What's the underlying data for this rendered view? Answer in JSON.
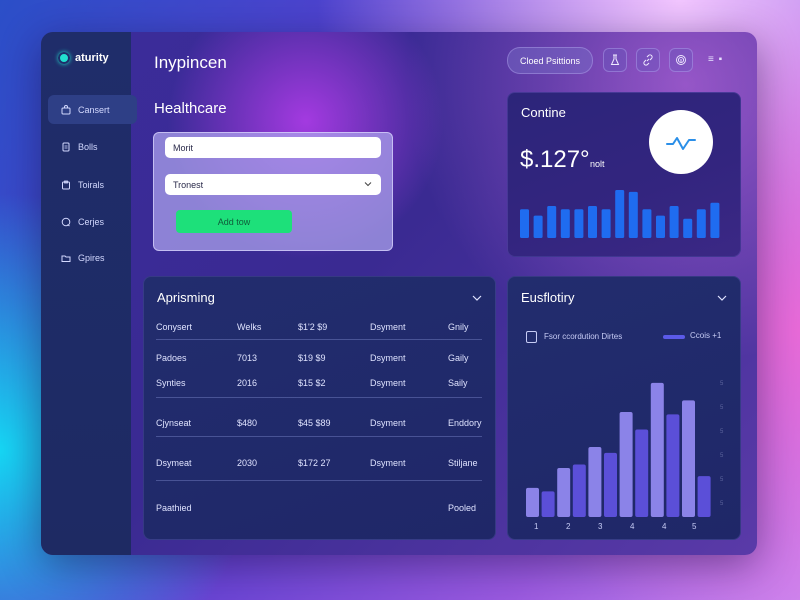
{
  "app": {
    "logo_text": "aturity",
    "title": "Inypincen",
    "top_button": "Cloed Psittions",
    "top_icons": [
      "flask-icon",
      "link-icon",
      "fingerprint-icon"
    ],
    "menu": "≡ ▪"
  },
  "sidebar": {
    "items": [
      {
        "label": "Cansert",
        "icon": "bag-icon",
        "active": true
      },
      {
        "label": "Bolls",
        "icon": "document-icon",
        "active": false
      },
      {
        "label": "Toirals",
        "icon": "clipboard-icon",
        "active": false
      },
      {
        "label": "Cerjes",
        "icon": "chat-icon",
        "active": false
      },
      {
        "label": "Gpires",
        "icon": "folder-icon",
        "active": false
      }
    ]
  },
  "form": {
    "section_title": "Healthcare",
    "field1_value": "Morit",
    "field2_value": "Tronest",
    "button_label": "Add tow"
  },
  "stat_card": {
    "title": "Contine",
    "value": "$.127°",
    "unit": "nolt",
    "bars": [
      0.45,
      0.35,
      0.5,
      0.45,
      0.45,
      0.5,
      0.45,
      0.75,
      0.72,
      0.45,
      0.35,
      0.5,
      0.3,
      0.45,
      0.55
    ]
  },
  "table": {
    "title": "Aprisming",
    "rows": [
      [
        "Conysert",
        "Welks",
        "$1'2 $9",
        "Dsyment",
        "Gnily"
      ],
      [
        "Padoes",
        "7013",
        "$19 $9",
        "Dsyment",
        "Gaily"
      ],
      [
        "Synties",
        "2016",
        "$15 $2",
        "Dsyment",
        "Saily"
      ],
      [
        "Cjynseat",
        "$480",
        "$45 $89",
        "Dsyment",
        "Enddory"
      ],
      [
        "Dsymeat",
        "2030",
        "$172 27",
        "Dsyment",
        "Stiljane"
      ],
      [
        "Paathied",
        "",
        "",
        "",
        "Pooled"
      ]
    ]
  },
  "chart_data": {
    "type": "bar",
    "title": "Eusflotiry",
    "legend_label": "Fsor ccordution Dirtes",
    "series": [
      {
        "name": "Ccois +1",
        "color": "#8b83e8",
        "values": [
          25,
          30,
          42,
          50,
          60,
          62,
          90,
          80,
          115,
          95,
          100,
          40
        ]
      },
      {
        "name": "",
        "color": "#5b4fd8",
        "values": [
          18,
          22,
          36,
          45,
          52,
          55,
          82,
          75,
          108,
          88,
          92,
          35
        ]
      }
    ],
    "categories": [
      "1",
      "2",
      "3",
      "4",
      "4",
      "5"
    ],
    "ylim": [
      0,
      120
    ],
    "grid": false
  },
  "colors": {
    "accent_green": "#1de07a",
    "bar_blue": "#1f6cf0",
    "chart_light": "#8b83e8",
    "chart_dark": "#5b4fd8",
    "sidebar": "#1f2d6a"
  }
}
